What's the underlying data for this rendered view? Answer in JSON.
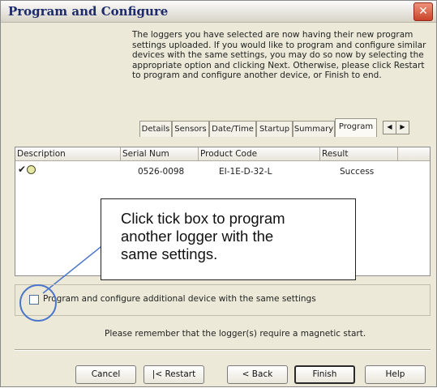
{
  "window": {
    "title": "Program and Configure",
    "close_glyph": "✕"
  },
  "intro_text": "The loggers you have selected are now having their new program settings uploaded. If you would like to program and configure similar devices with the same settings, you may do so now by selecting the appropriate option and clicking Next. Otherwise, please click Restart to program and configure another device, or Finish to end.",
  "tabs": [
    "Details",
    "Sensors",
    "Date/Time",
    "Startup",
    "Summary",
    "Program"
  ],
  "active_tab": "Program",
  "tab_arrows": [
    "◀",
    "▶"
  ],
  "list": {
    "columns": [
      "Description",
      "Serial Num",
      "Product Code",
      "Result"
    ],
    "rows": [
      {
        "check": "✔",
        "icon": "logger-icon",
        "serial": "0526-0098",
        "product_code": "EI-1E-D-32-L",
        "result": "Success"
      }
    ]
  },
  "callout_lines": [
    "Click tick box to program",
    "another logger with the",
    "same settings."
  ],
  "option": {
    "checked": false,
    "label": "Program and configure additional device with the same settings"
  },
  "note": "Please remember that the logger(s) require a magnetic start.",
  "buttons": {
    "cancel": "Cancel",
    "restart": "|< Restart",
    "back": "< Back",
    "finish": "Finish",
    "help": "Help"
  },
  "colors": {
    "dialog_bg": "#ece9d8",
    "title_text": "#1d2a6b",
    "highlight_circle": "#4c76c9",
    "close_button": "#d9533a"
  }
}
